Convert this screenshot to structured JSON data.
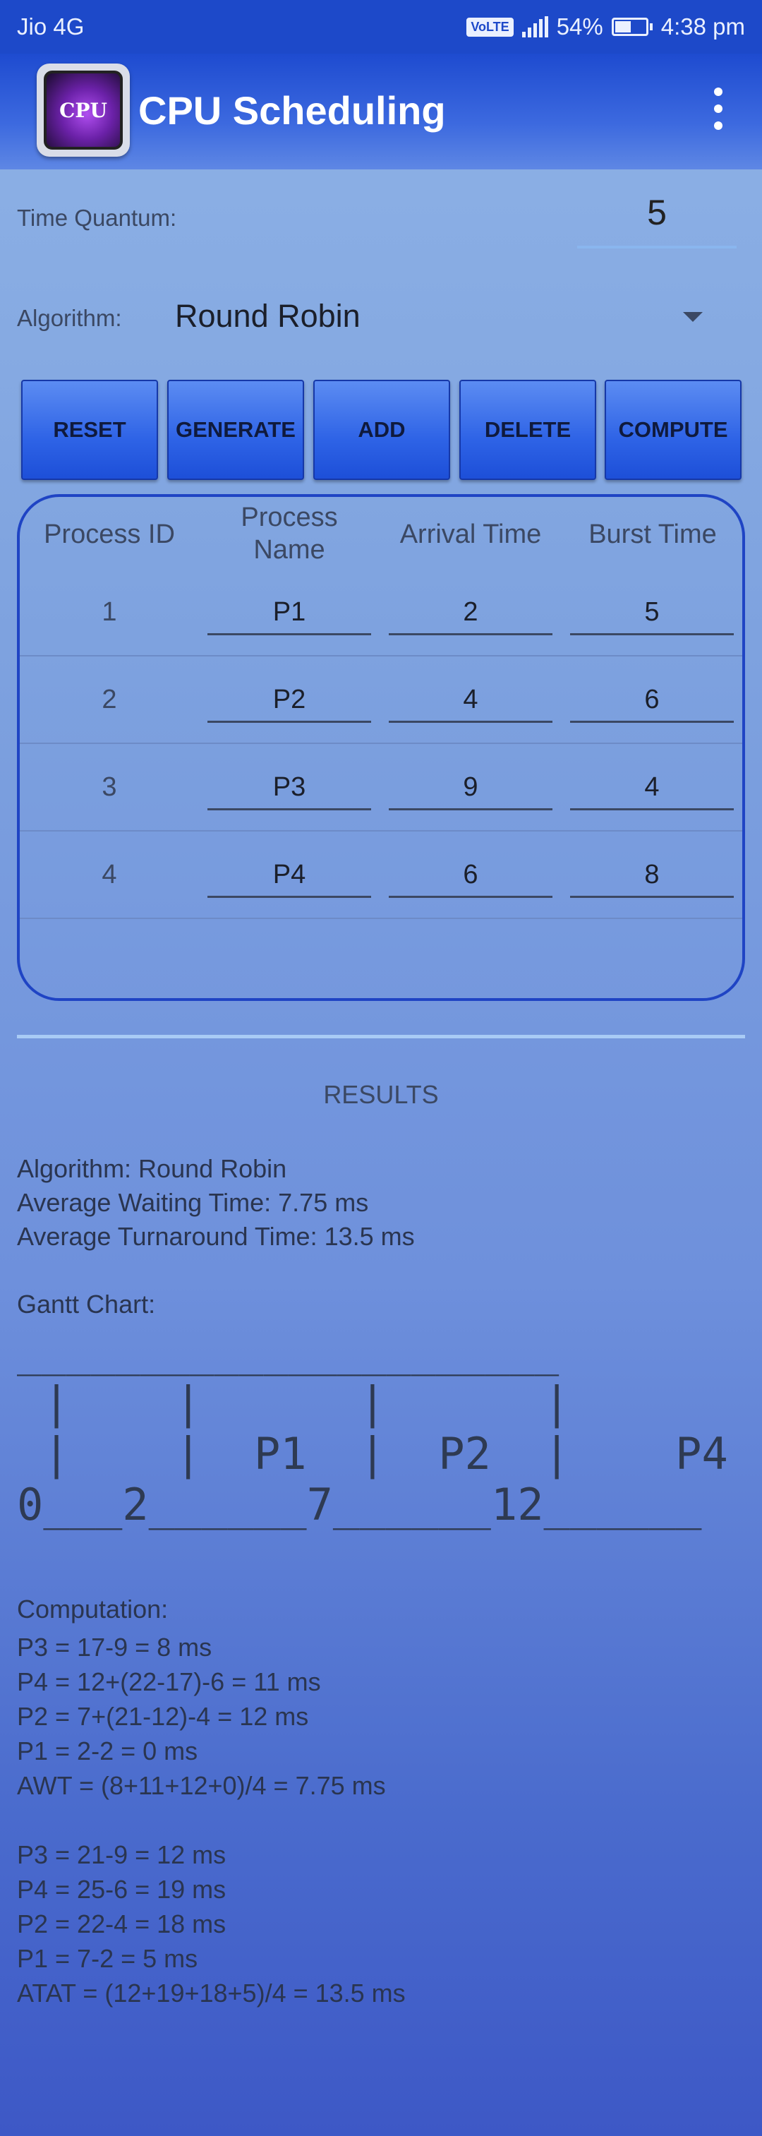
{
  "status": {
    "carrier": "Jio 4G",
    "volte": "VoLTE",
    "battery": "54%",
    "time": "4:38 pm"
  },
  "app": {
    "icon_text": "CPU",
    "title": "CPU Scheduling"
  },
  "form": {
    "time_quantum_label": "Time Quantum:",
    "time_quantum_value": "5",
    "algorithm_label": "Algorithm:",
    "algorithm_value": "Round Robin"
  },
  "buttons": {
    "reset": "RESET",
    "generate": "GENERATE",
    "add": "ADD",
    "delete": "DELETE",
    "compute": "COMPUTE"
  },
  "table": {
    "headers": {
      "id": "Process ID",
      "name_line1": "Process",
      "name_line2": "Name",
      "arrival": "Arrival Time",
      "burst": "Burst Time"
    },
    "rows": [
      {
        "id": "1",
        "name": "P1",
        "arrival": "2",
        "burst": "5"
      },
      {
        "id": "2",
        "name": "P2",
        "arrival": "4",
        "burst": "6"
      },
      {
        "id": "3",
        "name": "P3",
        "arrival": "9",
        "burst": "4"
      },
      {
        "id": "4",
        "name": "P4",
        "arrival": "6",
        "burst": "8"
      }
    ]
  },
  "results": {
    "title": "RESULTS",
    "algorithm": "Algorithm: Round Robin",
    "awt": "Average Waiting Time: 7.75 ms",
    "att": "Average Turnaround Time: 13.5 ms",
    "gantt_label": "Gantt Chart:",
    "gantt_line1": "______________________",
    "gantt_line2": " |    |      |      |",
    "gantt_line3": " |    |  P1  |  P2  |    P4",
    "gantt_line4": "0___2______7______12______",
    "computation_label": "Computation:",
    "computation": [
      "P3 = 17-9 = 8 ms",
      "P4 = 12+(22-17)-6 = 11 ms",
      "P2 = 7+(21-12)-4 = 12 ms",
      "P1 = 2-2 = 0 ms",
      "AWT = (8+11+12+0)/4 = 7.75 ms",
      "",
      "P3 = 21-9 = 12 ms",
      "P4 = 25-6 = 19 ms",
      "P2 = 22-4 = 18 ms",
      "P1 = 7-2 = 5 ms",
      "ATAT = (12+19+18+5)/4 = 13.5 ms"
    ]
  }
}
